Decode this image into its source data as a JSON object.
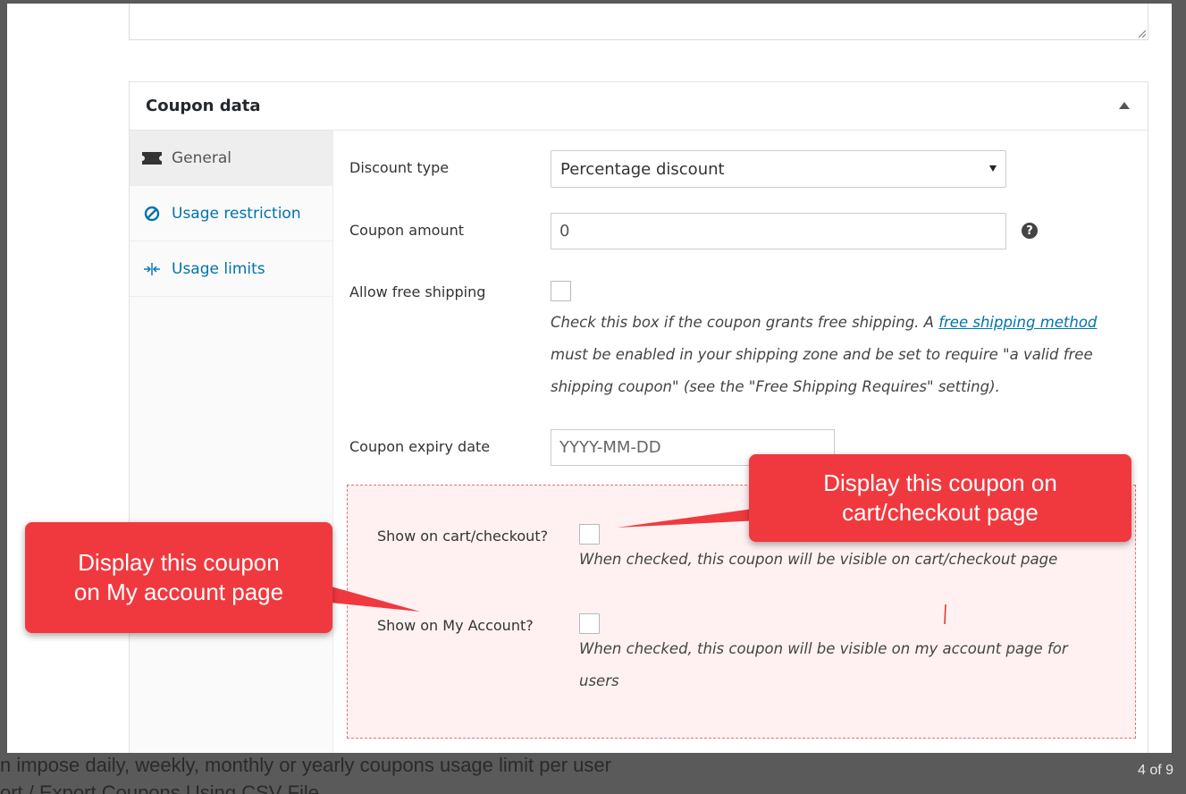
{
  "background": {
    "line1": "n impose daily, weekly, monthly or yearly coupons usage limit per user",
    "line2": "ort / Export Coupons Using CSV File",
    "counter": "4 of 9"
  },
  "panel": {
    "title": "Coupon data"
  },
  "tabs": [
    {
      "label": "General",
      "icon": "ticket-icon"
    },
    {
      "label": "Usage restriction",
      "icon": "restricted-icon"
    },
    {
      "label": "Usage limits",
      "icon": "limits-icon"
    }
  ],
  "fields": {
    "discount_type": {
      "label": "Discount type",
      "value": "Percentage discount"
    },
    "coupon_amount": {
      "label": "Coupon amount",
      "value": "0"
    },
    "free_shipping": {
      "label": "Allow free shipping",
      "desc_part1": "Check this box if the coupon grants free shipping. A ",
      "desc_link": "free shipping method",
      "desc_line2": "must be enabled in your shipping zone and be set to require \"a valid free",
      "desc_line3": "shipping coupon\" (see the \"Free Shipping Requires\" setting)."
    },
    "expiry_date": {
      "label": "Coupon expiry date",
      "placeholder": "YYYY-MM-DD"
    },
    "show_cart": {
      "label": "Show on cart/checkout?",
      "desc": "When checked, this coupon will be visible on cart/checkout page"
    },
    "show_account": {
      "label": "Show on My Account?",
      "desc_line1": "When checked, this coupon will be visible on my account page for",
      "desc_line2": "users"
    }
  },
  "callouts": {
    "cart": {
      "line1": "Display this coupon on",
      "line2": "cart/checkout page"
    },
    "account": {
      "line1": "Display this coupon",
      "line2": "on My account page"
    }
  },
  "colors": {
    "callout": "#f0393f",
    "link": "#0073aa",
    "highlight_bg": "#fff1f1"
  }
}
